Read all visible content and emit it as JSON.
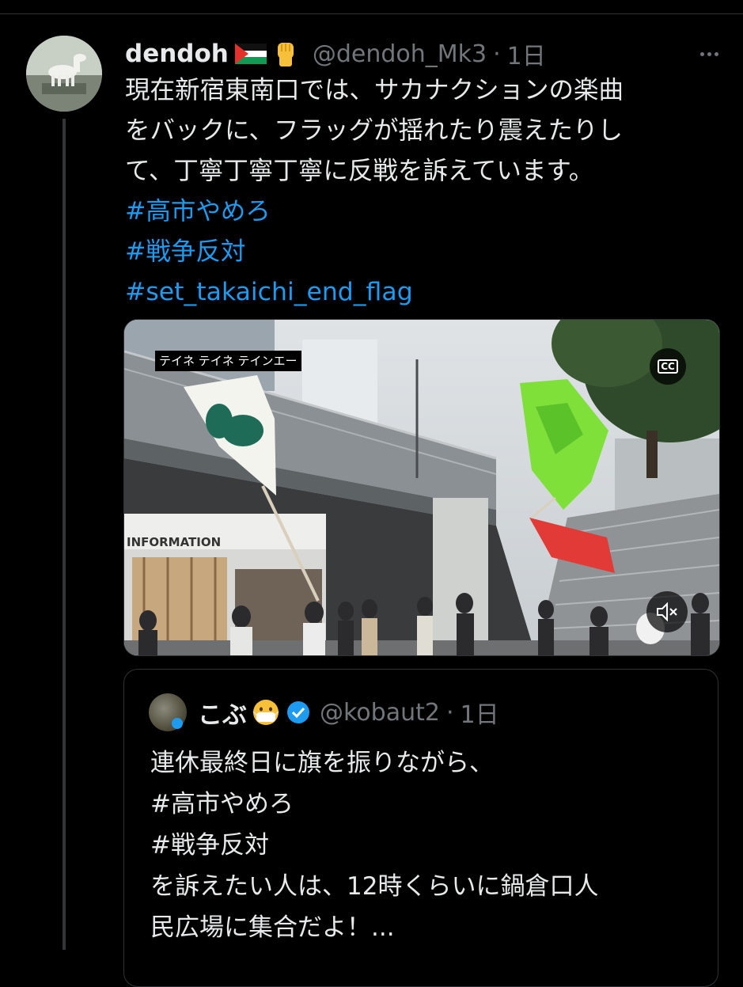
{
  "tweet": {
    "display_name": "dendoh",
    "handle": "@dendoh_Mk3",
    "separator": "·",
    "time": "1日",
    "text_lines": [
      "現在新宿東南口では、サカナクションの楽曲",
      "をバックに、フラッグが揺れたり震えたりし",
      "て、丁寧丁寧丁寧に反戦を訴えています。"
    ],
    "hashtags": [
      "#高市やめろ",
      "#戦争反対",
      "#set_takaichi_end_flag"
    ],
    "emoji_icons": [
      "palestine-flag-icon",
      "raised-fist-icon"
    ]
  },
  "video": {
    "caption": "テイネ テイネ テインエー",
    "sign_text": "INFORMATION",
    "cc_label": "CC",
    "icons": [
      "captions-icon",
      "muted-speaker-icon"
    ]
  },
  "quoted_tweet": {
    "display_name": "こぶ",
    "handle": "@kobaut2",
    "separator": "·",
    "time": "1日",
    "text_lines": [
      "連休最終日に旗を振りながら、",
      "#高市やめろ",
      "#戦争反対",
      "を訴えたい人は、12時くらいに鍋倉口人",
      "民広場に集合だよ！..."
    ],
    "emoji_icons": [
      "face-with-mask-icon",
      "verified-badge-icon"
    ]
  },
  "colors": {
    "background": "#000000",
    "text": "#e7e9ea",
    "secondary": "#71767b",
    "link": "#1d9bf0",
    "border": "#2f3336"
  }
}
